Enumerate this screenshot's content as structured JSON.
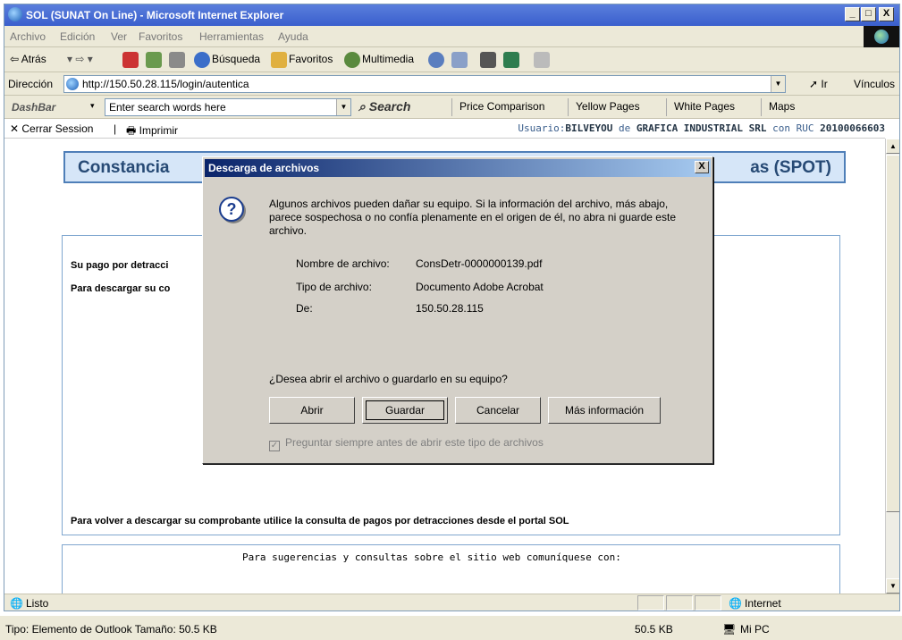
{
  "window": {
    "title": "SOL (SUNAT On Line) - Microsoft Internet Explorer",
    "min": "_",
    "max": "□",
    "close": "X"
  },
  "menu": [
    "Archivo",
    "Edición",
    "Ver",
    "Favoritos",
    "Herramientas",
    "Ayuda"
  ],
  "toolbar": {
    "back": "⇦ Atrás",
    "search": "Búsqueda",
    "favorites": "Favoritos",
    "multimedia": "Multimedia"
  },
  "address": {
    "label": "Dirección",
    "url": "http://150.50.28.115/login/autentica",
    "go": "Ir",
    "links": "Vínculos"
  },
  "dashbar": {
    "label": "DashBar",
    "placeholder": "Enter search words here",
    "search": "Search",
    "links": [
      "Price Comparison",
      "Yellow Pages",
      "White Pages",
      "Maps"
    ]
  },
  "sol": {
    "logout": "Cerrar Session",
    "print": "Imprimir",
    "user_prefix": "Usuario:",
    "user": "BILVEYOU",
    "de": "de",
    "company": "GRAFICA INDUSTRIAL SRL",
    "con_ruc": "con RUC",
    "ruc": "20100066603"
  },
  "page": {
    "heading_left": "Constancia",
    "heading_right": "as (SPOT)",
    "line1": "Su pago por detracci",
    "line2": "Para descargar su co",
    "line3": "Para volver a descargar su comprobante utilice la consulta de pagos por detracciones desde el portal SOL",
    "footer": "Para sugerencias y consultas sobre el sitio web comuníquese con:"
  },
  "dialog": {
    "title": "Descarga de archivos",
    "warning": "Algunos archivos pueden dañar su equipo. Si la información del archivo, más abajo, parece sospechosa o no confía plenamente en el origen de él, no abra ni guarde este archivo.",
    "filename_label": "Nombre de archivo:",
    "filename": "ConsDetr-0000000139.pdf",
    "type_label": "Tipo de archivo:",
    "type": "Documento Adobe Acrobat",
    "from_label": "De:",
    "from": "150.50.28.115",
    "question": "¿Desea abrir el archivo o guardarlo en su equipo?",
    "buttons": {
      "open": "Abrir",
      "save": "Guardar",
      "cancel": "Cancelar",
      "more": "Más información"
    },
    "checkbox": "Preguntar siempre antes de abrir este tipo de archivos",
    "close": "X"
  },
  "status": {
    "text": "Listo",
    "zone": "Internet"
  },
  "explorer_status": {
    "text": "Tipo: Elemento de Outlook Tamaño: 50.5 KB",
    "size": "50.5 KB",
    "location": "Mi PC"
  }
}
